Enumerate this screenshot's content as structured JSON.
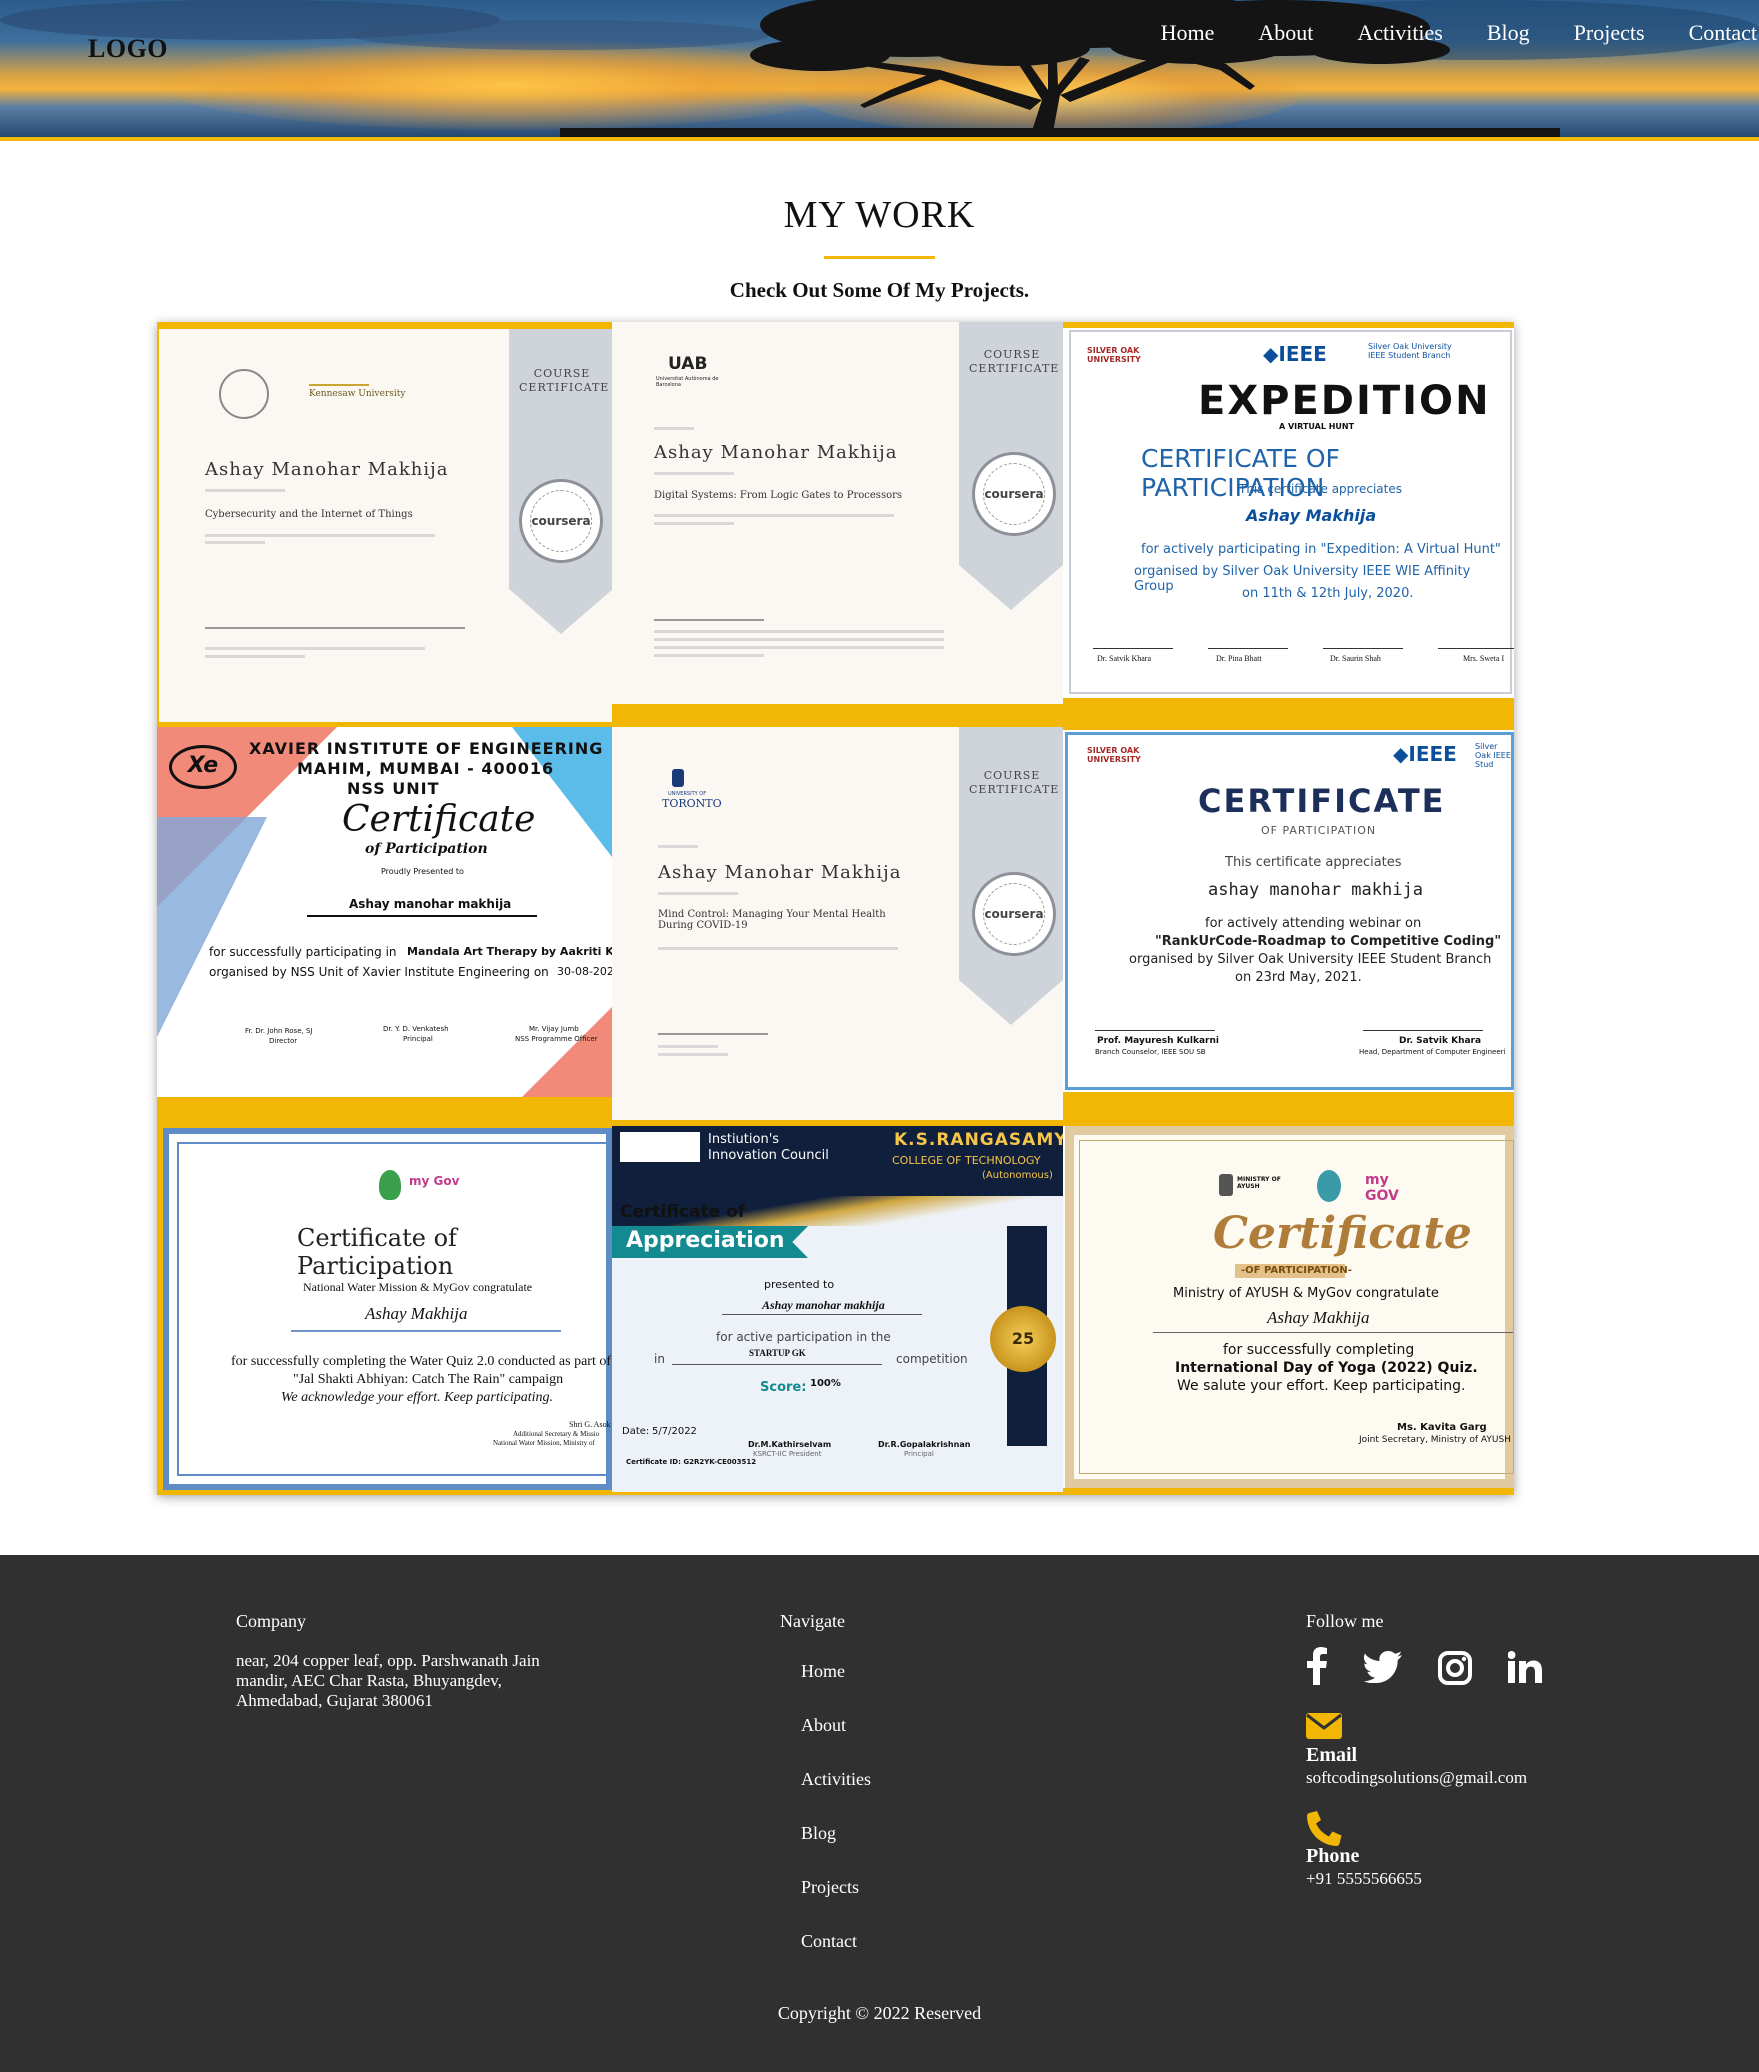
{
  "header": {
    "logo": "LOGO",
    "nav": [
      "Home",
      "About",
      "Activities",
      "Blog",
      "Projects",
      "Contact"
    ]
  },
  "main": {
    "title": "MY WORK",
    "subtitle": "Check Out Some Of My Projects.",
    "certificates": {
      "c1": {
        "label": "COURSE CERTIFICATE",
        "name": "Ashay Manohar Makhija",
        "course": "Cybersecurity and the Internet of Things",
        "seal": "coursera",
        "org": "Kennesaw University"
      },
      "c2": {
        "label": "COURSE CERTIFICATE",
        "name": "Ashay Manohar Makhija",
        "course": "Digital Systems: From Logic Gates to Processors",
        "seal": "coursera",
        "org": "UAB",
        "org_sub": "Universitat Autònoma de Barcelona"
      },
      "c3": {
        "brand": "IEEE",
        "uni": "SILVER OAK UNIVERSITY",
        "branch": "Silver Oak University IEEE Student Branch",
        "event": "EXPEDITION",
        "event_sub": "A VIRTUAL HUNT",
        "heading": "CERTIFICATE OF PARTICIPATION",
        "appreciates": "This certificate appreciates",
        "name": "Ashay Makhija",
        "line1": "for actively participating in \"Expedition: A Virtual Hunt\"",
        "line2": "organised by Silver Oak University IEEE WIE Affinity Group",
        "line3": "on 11th & 12th July, 2020.",
        "sig": [
          "Dr. Satvik Khara",
          "Dr. Pina Bhatt",
          "Dr. Saurin Shah",
          "Mrs. Sweta I"
        ]
      },
      "c4": {
        "inst1": "XAVIER INSTITUTE OF ENGINEERING",
        "inst2": "MAHIM, MUMBAI - 400016",
        "inst3": "NSS UNIT",
        "heading": "Certificate",
        "sub": "of Participation",
        "presented": "Proudly Presented to",
        "name": "Ashay manohar makhija",
        "line1": "for successfully participating in",
        "event": "Mandala Art Therapy by Aakriti Kho",
        "line2": "organised by NSS Unit of Xavier Institute Engineering on",
        "date": "30-08-202",
        "sig": [
          "Fr. Dr. John Rose, SJ",
          "Dr. Y. D. Venkatesh",
          "Mr. Vijay Jumb"
        ],
        "sig_role": [
          "Director",
          "Principal",
          "NSS Programme Officer"
        ]
      },
      "c5": {
        "label": "COURSE CERTIFICATE",
        "name": "Ashay Manohar Makhija",
        "course": "Mind Control: Managing Your Mental Health During COVID-19",
        "seal": "coursera",
        "org": "TORONTO",
        "org_sub": "UNIVERSITY OF"
      },
      "c6": {
        "brand": "IEEE",
        "uni": "SILVER OAK UNIVERSITY",
        "branch": "Silver Oak IEEE Stud",
        "heading": "CERTIFICATE",
        "sub": "OF PARTICIPATION",
        "appreciates": "This certificate appreciates",
        "name": "ashay manohar makhija",
        "line1": "for actively attending webinar on",
        "line2": "\"RankUrCode-Roadmap to Competitive Coding\"",
        "line3": "organised by Silver Oak University IEEE Student Branch",
        "line4": "on 23rd May, 2021.",
        "sig": [
          "Prof. Mayuresh Kulkarni",
          "Dr. Satvik Khara"
        ],
        "sig_role": [
          "Branch Counselor, IEEE SOU SB",
          "Head, Department of Computer Engineeri"
        ]
      },
      "c7": {
        "brand": "my Gov",
        "heading": "Certificate of Participation",
        "line1": "National Water Mission & MyGov congratulate",
        "name": "Ashay Makhija",
        "line2": "for successfully completing the Water Quiz 2.0 conducted as part of",
        "line3": "\"Jal Shakti Abhiyan: Catch The Rain\" campaign",
        "line4": "We acknowledge your effort. Keep participating.",
        "sig": "Shri G. Asok",
        "sig_role1": "Additional Secretary & Missio",
        "sig_role2": "National Water Mission, Ministry of"
      },
      "c8": {
        "council": "Instiution's Innovation Council",
        "college": "K.S.RANGASAMY",
        "college_sub": "COLLEGE OF TECHNOLOGY",
        "autonomous": "(Autonomous)",
        "heading1": "Certificate of",
        "heading2": "Appreciation",
        "presented": "presented to",
        "name": "Ashay manohar makhija",
        "line1": "for active participation in the",
        "in": "in",
        "event": "STARTUP GK",
        "competition": "competition",
        "score_label": "Score:",
        "score": "100%",
        "date_label": "Date:",
        "date": "5/7/2022",
        "sig": [
          "Dr.M.Kathirselvam",
          "Dr.R.Gopalakrishnan"
        ],
        "sig_role": [
          "KSRCT-IIC President",
          "Principal"
        ],
        "cert_id": "Certificate ID: G2R2YK-CE003512",
        "badge": "25"
      },
      "c9": {
        "ministry": "MINISTRY OF AYUSH",
        "heading": "Certificate",
        "sub": "-OF PARTICIPATION-",
        "line1": "Ministry of AYUSH & MyGov congratulate",
        "name": "Ashay Makhija",
        "line2": "for successfully completing",
        "line3": "International Day of Yoga (2022) Quiz.",
        "line4": "We salute your effort. Keep participating.",
        "sig": "Ms. Kavita Garg",
        "sig_role": "Joint Secretary, Ministry of AYUSH"
      }
    }
  },
  "footer": {
    "company_heading": "Company",
    "address": "near, 204 copper leaf, opp. Parshwanath Jain mandir, AEC Char Rasta, Bhuyangdev, Ahmedabad, Gujarat 380061",
    "navigate_heading": "Navigate",
    "nav": [
      "Home",
      "About",
      "Activities",
      "Blog",
      "Projects",
      "Contact"
    ],
    "follow_heading": "Follow me",
    "email_label": "Email",
    "email": "softcodingsolutions@gmail.com",
    "phone_label": "Phone",
    "phone": "+91 5555566655",
    "copyright": "Copyright © 2022 Reserved",
    "accent": "#f2b705"
  }
}
